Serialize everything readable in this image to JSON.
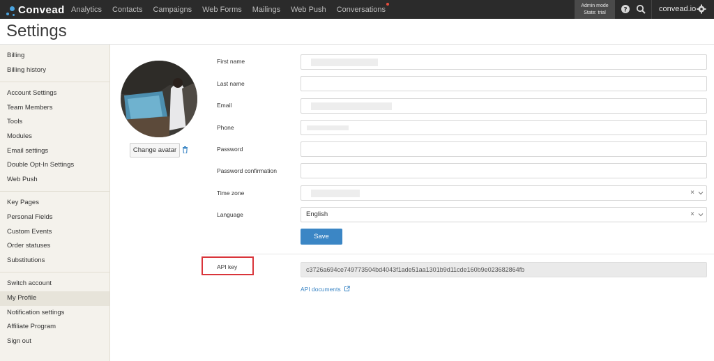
{
  "brand": {
    "logo_text": "Convead",
    "accent": "#4aa3df"
  },
  "nav": {
    "items": [
      "Analytics",
      "Contacts",
      "Campaigns",
      "Web Forms",
      "Mailings",
      "Web Push",
      "Conversations"
    ]
  },
  "admin": {
    "line1": "Admin mode",
    "line2": "State: trial"
  },
  "header": {
    "site": "convead.io",
    "help_icon": "question-circle-icon",
    "search_icon": "search-icon",
    "settings_icon": "gear-icon"
  },
  "page": {
    "title": "Settings"
  },
  "sidebar": {
    "groups": [
      [
        "Billing",
        "Billing history"
      ],
      [
        "Account Settings",
        "Team Members",
        "Tools",
        "Modules",
        "Email settings",
        "Double Opt-In Settings",
        "Web Push"
      ],
      [
        "Key Pages",
        "Personal Fields",
        "Custom Events",
        "Order statuses",
        "Substitutions"
      ],
      [
        "Switch account",
        "My Profile",
        "Notification settings",
        "Affiliate Program",
        "Sign out"
      ]
    ],
    "active": "My Profile"
  },
  "profile": {
    "change_avatar": "Change avatar",
    "fields": {
      "first_name": "First name",
      "last_name": "Last name",
      "email": "Email",
      "phone": "Phone",
      "password": "Password",
      "password_confirmation": "Password confirmation",
      "time_zone": "Time zone",
      "language": "Language"
    },
    "language_value": "English",
    "clear_symbol": "×",
    "save_label": "Save"
  },
  "api": {
    "label": "API key",
    "key": "c3726a694ce749773504bd4043f1ade51aa1301b9d11cde160b9e023682864fb",
    "docs_label": "API documents"
  },
  "colors": {
    "save_button": "#3b86c5",
    "highlight_border": "#d9343a"
  }
}
